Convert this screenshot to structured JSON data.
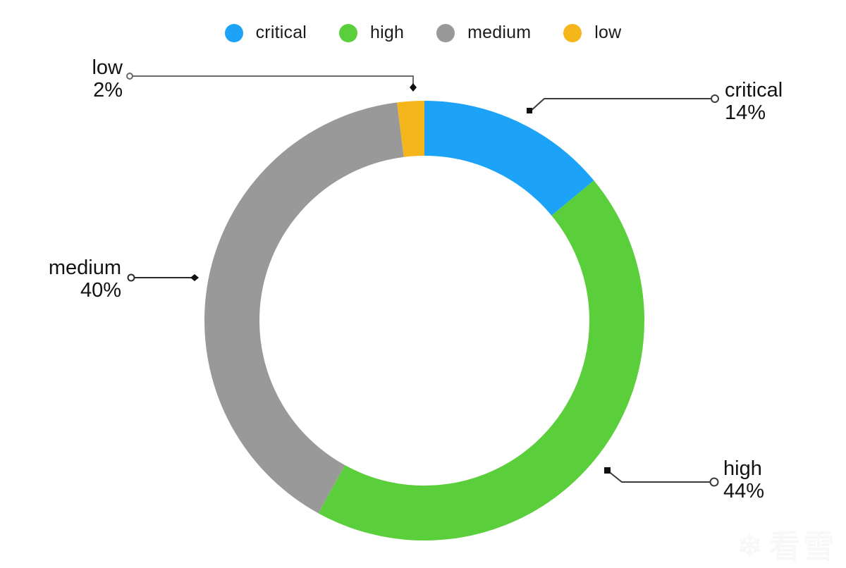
{
  "legend": {
    "position": "top-center",
    "items": [
      {
        "label": "critical",
        "color": "#1CA3F7",
        "swatch_icon": "circle-swatch-icon"
      },
      {
        "label": "high",
        "color": "#5BCE3B",
        "swatch_icon": "circle-swatch-icon"
      },
      {
        "label": "medium",
        "color": "#999999",
        "swatch_icon": "circle-swatch-icon"
      },
      {
        "label": "low",
        "color": "#F5B61B",
        "swatch_icon": "circle-swatch-icon"
      }
    ]
  },
  "callouts": {
    "low": {
      "category": "low",
      "percent": "2%"
    },
    "critical": {
      "category": "critical",
      "percent": "14%"
    },
    "medium": {
      "category": "medium",
      "percent": "40%"
    },
    "high": {
      "category": "high",
      "percent": "44%"
    }
  },
  "watermark": {
    "mark": "❄",
    "text": "看雪"
  },
  "chart_data": {
    "type": "pie",
    "variant": "donut",
    "title": "",
    "subtitle": "",
    "xlabel": "",
    "ylabel": "",
    "legend_position": "top-center",
    "grid": false,
    "unit": "percent",
    "start_angle_deg": 0,
    "direction": "clockwise",
    "inner_radius_ratio": 0.75,
    "categories": [
      "critical",
      "high",
      "medium",
      "low"
    ],
    "values": [
      14,
      44,
      40,
      2
    ],
    "colors": [
      "#1CA3F7",
      "#5BCE3B",
      "#999999",
      "#F5B61B"
    ],
    "labels": [
      "critical 14%",
      "high 44%",
      "medium 40%",
      "low 2%"
    ],
    "slices": [
      {
        "name": "critical",
        "value": 14,
        "label": "14%",
        "color": "#1CA3F7"
      },
      {
        "name": "high",
        "value": 44,
        "label": "44%",
        "color": "#5BCE3B"
      },
      {
        "name": "medium",
        "value": 40,
        "label": "40%",
        "color": "#999999"
      },
      {
        "name": "low",
        "value": 2,
        "label": "2%",
        "color": "#F5B61B"
      }
    ]
  }
}
